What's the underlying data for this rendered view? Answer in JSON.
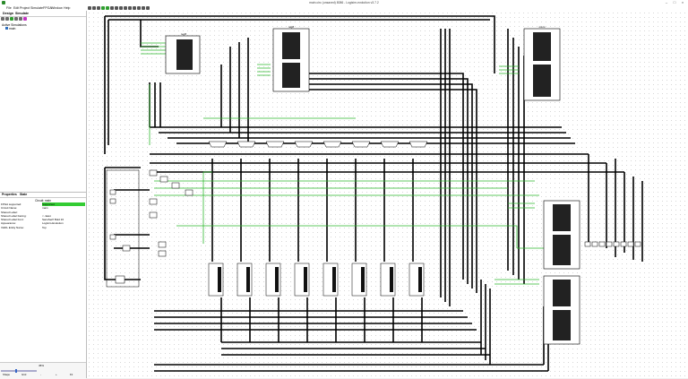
{
  "window": {
    "title": "main.circ (unsaved) 8086 - Logisim-evolution v3.7.2",
    "controls": [
      "minimize",
      "maximize",
      "close"
    ]
  },
  "menubar": [
    "File",
    "Edit",
    "Project",
    "Simulate",
    "FPGA",
    "Window",
    "Help"
  ],
  "left_panel": {
    "tabs": [
      "Design",
      "Simulate"
    ],
    "tools": [
      "undo-icon",
      "redo-icon",
      "play-icon",
      "step-icon",
      "tick-icon",
      "settings-icon"
    ],
    "tree": [
      {
        "label": "Active Simulations",
        "indent": 0
      },
      {
        "label": "main",
        "indent": 1
      }
    ]
  },
  "properties": {
    "tabs": [
      "Properties",
      "State"
    ],
    "title": "Circuit: main",
    "rows": [
      {
        "key": "FPGA supported:",
        "value": "Supported",
        "highlight": true
      },
      {
        "key": "Circuit Name:",
        "value": "main",
        "highlight": false
      },
      {
        "key": "Shared Label:",
        "value": "",
        "highlight": false
      },
      {
        "key": "Shared Label Facing:",
        "value": "<- East",
        "highlight": false
      },
      {
        "key": "Shared Label Font:",
        "value": "SansSerif Bold 16",
        "highlight": false
      },
      {
        "key": "Appearance:",
        "value": "Logisim-Evolution",
        "highlight": false
      },
      {
        "key": "VHDL Entity Name:",
        "value": "Top",
        "highlight": false
      }
    ]
  },
  "zoom": {
    "value": "45%",
    "buttons": [
      "Shape",
      "Grid",
      "-",
      "+",
      "Fit"
    ]
  },
  "canvas": {
    "wire_colors": {
      "bus": "#000000",
      "signal": "#2fb82f"
    },
    "component_labels": [
      "reg8",
      "reg8",
      "mem"
    ]
  }
}
